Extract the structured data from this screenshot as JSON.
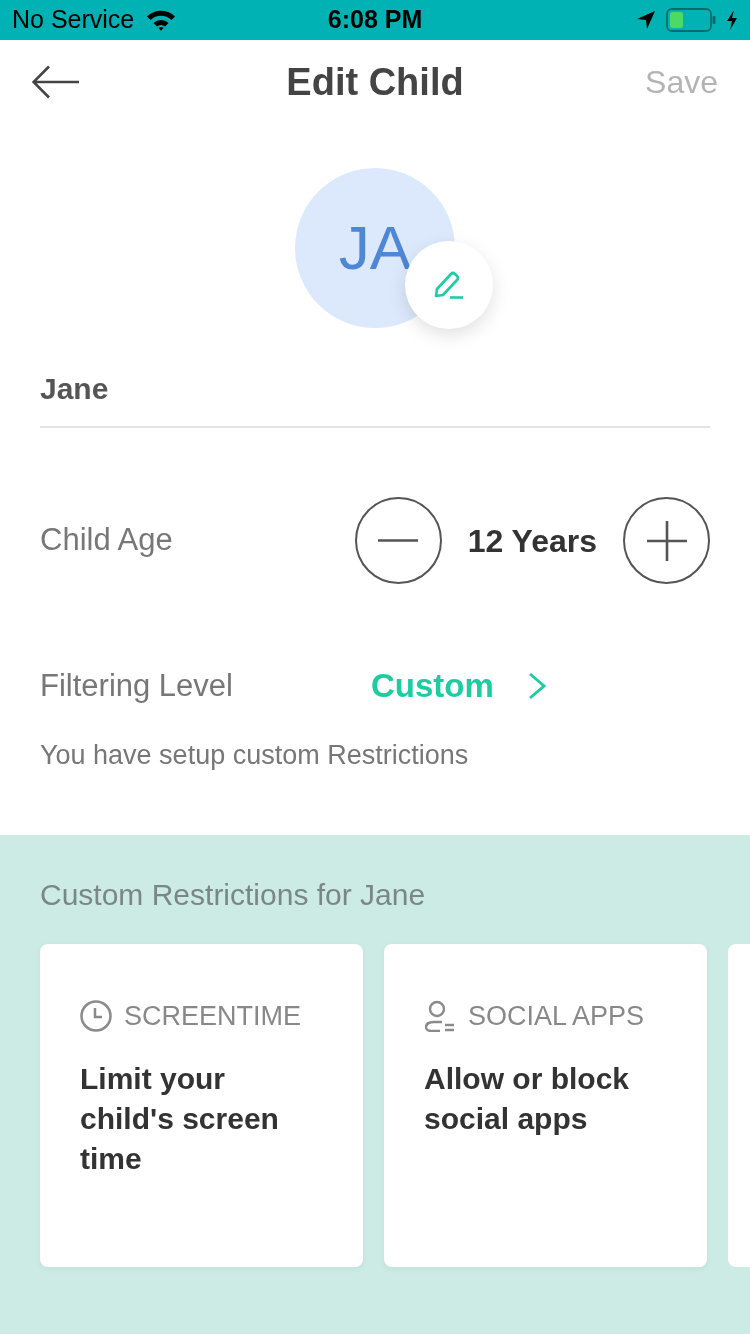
{
  "status_bar": {
    "carrier": "No Service",
    "time": "6:08 PM"
  },
  "header": {
    "title": "Edit Child",
    "save": {
      "label": "Save",
      "disabled": true
    }
  },
  "avatar": {
    "initials": "JA"
  },
  "name_field": {
    "value": "Jane"
  },
  "age": {
    "label": "Child Age",
    "value": "12 Years"
  },
  "filtering": {
    "label": "Filtering Level",
    "value": "Custom",
    "description": "You have setup custom Restrictions"
  },
  "restrictions": {
    "title": "Custom Restrictions for Jane",
    "cards": [
      {
        "kind": "screentime",
        "label": "SCREENTIME",
        "text": "Limit your child's screen time"
      },
      {
        "kind": "social",
        "label": "SOCIAL APPS",
        "text": "Allow or block social apps"
      }
    ]
  }
}
